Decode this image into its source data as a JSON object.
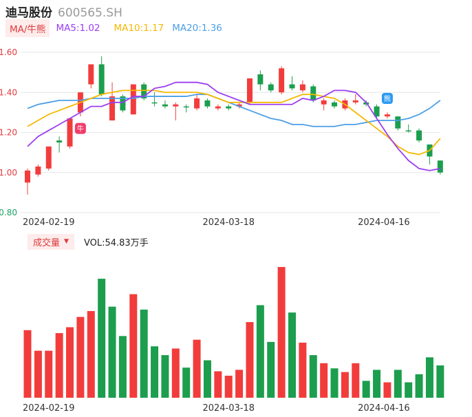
{
  "stock": {
    "name": "迪马股份",
    "code": "600565.SH"
  },
  "legend": {
    "tag": "MA/牛熊",
    "ma5": "MA5:1.02",
    "ma10": "MA10:1.17",
    "ma20": "MA20:1.36",
    "ma5_color": "#9b3df0",
    "ma10_color": "#f5b800",
    "ma20_color": "#4a9ee8"
  },
  "volume_legend": {
    "tag": "成交量",
    "value": "VOL:54.83万手"
  },
  "markers": {
    "bull": "牛",
    "bear": "熊"
  },
  "colors": {
    "up": "#f23c3c",
    "down": "#1c9e4e",
    "grid": "#e6e6e6"
  },
  "chart_data": [
    {
      "type": "candlestick",
      "ylim": [
        0.8,
        1.6
      ],
      "y_ticks": [
        "1.60",
        "1.40",
        "1.20",
        "1.00",
        "0.80"
      ],
      "x_tick_labels": [
        "2024-02-19",
        "2024-03-18",
        "2024-04-16"
      ],
      "candles": [
        {
          "o": 0.95,
          "c": 1.01,
          "h": 1.02,
          "l": 0.89,
          "dir": "up"
        },
        {
          "o": 0.99,
          "c": 1.03,
          "h": 1.04,
          "l": 0.98,
          "dir": "up"
        },
        {
          "o": 1.02,
          "c": 1.13,
          "h": 1.13,
          "l": 1.01,
          "dir": "up"
        },
        {
          "o": 1.16,
          "c": 1.15,
          "h": 1.18,
          "l": 1.1,
          "dir": "down"
        },
        {
          "o": 1.13,
          "c": 1.27,
          "h": 1.27,
          "l": 1.12,
          "dir": "up"
        },
        {
          "o": 1.3,
          "c": 1.4,
          "h": 1.4,
          "l": 1.28,
          "dir": "up"
        },
        {
          "o": 1.44,
          "c": 1.54,
          "h": 1.54,
          "l": 1.42,
          "dir": "up"
        },
        {
          "o": 1.54,
          "c": 1.39,
          "h": 1.58,
          "l": 1.38,
          "dir": "down"
        },
        {
          "o": 1.26,
          "c": 1.38,
          "h": 1.45,
          "l": 1.26,
          "dir": "up"
        },
        {
          "o": 1.38,
          "c": 1.31,
          "h": 1.39,
          "l": 1.3,
          "dir": "down"
        },
        {
          "o": 1.29,
          "c": 1.44,
          "h": 1.44,
          "l": 1.29,
          "dir": "up"
        },
        {
          "o": 1.44,
          "c": 1.37,
          "h": 1.45,
          "l": 1.36,
          "dir": "down"
        },
        {
          "o": 1.35,
          "c": 1.35,
          "h": 1.4,
          "l": 1.33,
          "dir": "down"
        },
        {
          "o": 1.34,
          "c": 1.33,
          "h": 1.36,
          "l": 1.32,
          "dir": "down"
        },
        {
          "o": 1.33,
          "c": 1.34,
          "h": 1.35,
          "l": 1.26,
          "dir": "up"
        },
        {
          "o": 1.33,
          "c": 1.33,
          "h": 1.34,
          "l": 1.3,
          "dir": "down"
        },
        {
          "o": 1.32,
          "c": 1.37,
          "h": 1.39,
          "l": 1.31,
          "dir": "up"
        },
        {
          "o": 1.36,
          "c": 1.33,
          "h": 1.37,
          "l": 1.32,
          "dir": "down"
        },
        {
          "o": 1.32,
          "c": 1.33,
          "h": 1.34,
          "l": 1.31,
          "dir": "up"
        },
        {
          "o": 1.33,
          "c": 1.32,
          "h": 1.34,
          "l": 1.31,
          "dir": "down"
        },
        {
          "o": 1.33,
          "c": 1.34,
          "h": 1.35,
          "l": 1.32,
          "dir": "up"
        },
        {
          "o": 1.35,
          "c": 1.47,
          "h": 1.47,
          "l": 1.34,
          "dir": "up"
        },
        {
          "o": 1.49,
          "c": 1.44,
          "h": 1.51,
          "l": 1.41,
          "dir": "down"
        },
        {
          "o": 1.44,
          "c": 1.41,
          "h": 1.45,
          "l": 1.4,
          "dir": "down"
        },
        {
          "o": 1.4,
          "c": 1.52,
          "h": 1.53,
          "l": 1.39,
          "dir": "up"
        },
        {
          "o": 1.44,
          "c": 1.42,
          "h": 1.48,
          "l": 1.41,
          "dir": "down"
        },
        {
          "o": 1.41,
          "c": 1.44,
          "h": 1.46,
          "l": 1.4,
          "dir": "up"
        },
        {
          "o": 1.43,
          "c": 1.36,
          "h": 1.44,
          "l": 1.35,
          "dir": "down"
        },
        {
          "o": 1.34,
          "c": 1.36,
          "h": 1.37,
          "l": 1.31,
          "dir": "up"
        },
        {
          "o": 1.35,
          "c": 1.33,
          "h": 1.36,
          "l": 1.32,
          "dir": "down"
        },
        {
          "o": 1.32,
          "c": 1.36,
          "h": 1.37,
          "l": 1.31,
          "dir": "up"
        },
        {
          "o": 1.35,
          "c": 1.36,
          "h": 1.39,
          "l": 1.34,
          "dir": "up"
        },
        {
          "o": 1.35,
          "c": 1.34,
          "h": 1.36,
          "l": 1.33,
          "dir": "down"
        },
        {
          "o": 1.33,
          "c": 1.28,
          "h": 1.34,
          "l": 1.27,
          "dir": "down"
        },
        {
          "o": 1.28,
          "c": 1.29,
          "h": 1.3,
          "l": 1.27,
          "dir": "up"
        },
        {
          "o": 1.28,
          "c": 1.22,
          "h": 1.28,
          "l": 1.21,
          "dir": "down"
        },
        {
          "o": 1.21,
          "c": 1.21,
          "h": 1.24,
          "l": 1.2,
          "dir": "down"
        },
        {
          "o": 1.21,
          "c": 1.16,
          "h": 1.22,
          "l": 1.15,
          "dir": "down"
        },
        {
          "o": 1.14,
          "c": 1.08,
          "h": 1.14,
          "l": 1.04,
          "dir": "down"
        },
        {
          "o": 1.06,
          "c": 1.0,
          "h": 1.06,
          "l": 0.99,
          "dir": "down"
        }
      ],
      "ma5": [
        1.13,
        1.18,
        1.21,
        1.24,
        1.27,
        1.3,
        1.33,
        1.33,
        1.35,
        1.35,
        1.38,
        1.38,
        1.42,
        1.43,
        1.45,
        1.45,
        1.45,
        1.44,
        1.4,
        1.38,
        1.36,
        1.34,
        1.34,
        1.34,
        1.34,
        1.34,
        1.37,
        1.36,
        1.38,
        1.41,
        1.41,
        1.4,
        1.35,
        1.27,
        1.19,
        1.12,
        1.06,
        1.02,
        1.01,
        1.02
      ],
      "ma10": [
        1.23,
        1.26,
        1.29,
        1.31,
        1.33,
        1.35,
        1.37,
        1.39,
        1.4,
        1.41,
        1.41,
        1.41,
        1.41,
        1.4,
        1.4,
        1.4,
        1.4,
        1.39,
        1.37,
        1.35,
        1.35,
        1.35,
        1.35,
        1.35,
        1.35,
        1.37,
        1.39,
        1.39,
        1.38,
        1.37,
        1.34,
        1.3,
        1.26,
        1.22,
        1.18,
        1.13,
        1.1,
        1.09,
        1.11,
        1.17
      ],
      "ma20": [
        1.32,
        1.34,
        1.35,
        1.36,
        1.36,
        1.36,
        1.37,
        1.37,
        1.37,
        1.37,
        1.37,
        1.38,
        1.38,
        1.38,
        1.38,
        1.38,
        1.39,
        1.39,
        1.37,
        1.35,
        1.33,
        1.31,
        1.29,
        1.27,
        1.26,
        1.24,
        1.24,
        1.23,
        1.23,
        1.23,
        1.24,
        1.24,
        1.25,
        1.26,
        1.26,
        1.26,
        1.27,
        1.29,
        1.32,
        1.36
      ]
    },
    {
      "type": "bar",
      "name": "成交量",
      "values": [
        92,
        64,
        64,
        88,
        96,
        110,
        118,
        162,
        124,
        84,
        141,
        120,
        70,
        58,
        67,
        41,
        79,
        51,
        36,
        30,
        38,
        103,
        126,
        76,
        178,
        116,
        75,
        58,
        47,
        40,
        35,
        47,
        23,
        38,
        21,
        38,
        21,
        32,
        55,
        44
      ],
      "directions": [
        "up",
        "up",
        "up",
        "up",
        "up",
        "up",
        "up",
        "down",
        "down",
        "down",
        "up",
        "down",
        "down",
        "down",
        "up",
        "down",
        "up",
        "down",
        "up",
        "up",
        "up",
        "up",
        "down",
        "down",
        "up",
        "down",
        "up",
        "down",
        "up",
        "down",
        "up",
        "up",
        "down",
        "down",
        "up",
        "down",
        "down",
        "down",
        "down",
        "down"
      ]
    }
  ]
}
